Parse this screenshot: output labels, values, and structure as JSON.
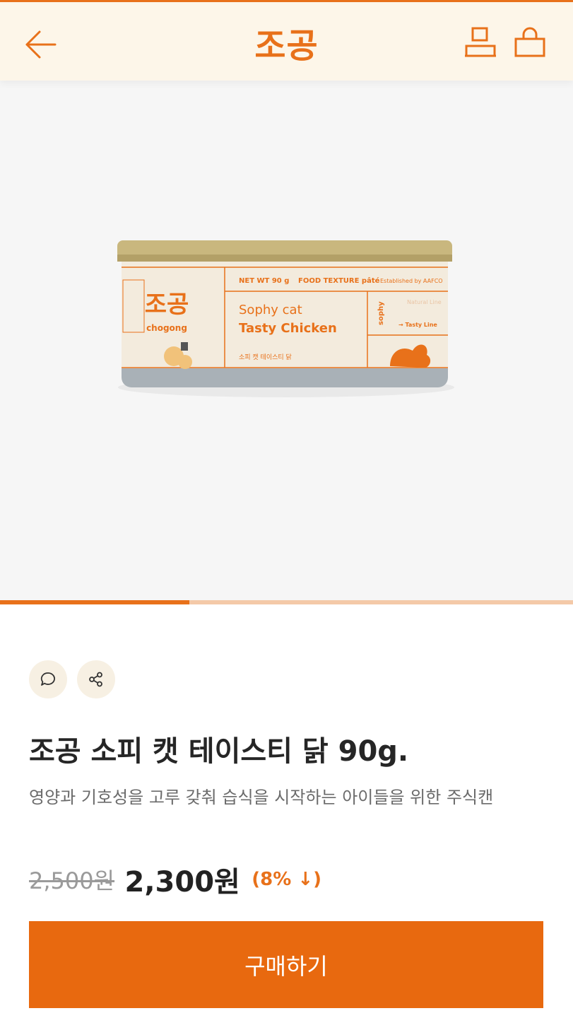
{
  "header": {
    "logo_text": "조공",
    "back_icon": "arrow-left-icon",
    "user_icon": "user-icon",
    "bag_icon": "shopping-bag-icon"
  },
  "product_image": {
    "label_brand": "조공",
    "label_brand_en": "chogong",
    "label_net_wt": "NET WT 90 g",
    "label_texture": "FOOD TEXTURE pâté",
    "label_established": "Established by AAFCO",
    "label_line": "Sophy cat",
    "label_flavor": "Tasty Chicken",
    "label_korean": "소피 캣 테이스티 닭",
    "label_side": "sophy",
    "label_natural": "Natural Line",
    "label_tasty_line": "→ Tasty Line"
  },
  "gallery": {
    "progress": 0.33
  },
  "actions": {
    "comment_icon": "speech-bubble-icon",
    "share_icon": "share-icon"
  },
  "product": {
    "title": "조공 소피 캣 테이스티 닭 90g.",
    "subtitle": "영양과 기호성을 고루 갖춰 습식을 시작하는 아이들을 위한 주식캔",
    "original_price": "2,500원",
    "sale_price": "2,300원",
    "discount": "(8% ↓)"
  },
  "buy_button": {
    "label": "구매하기"
  },
  "colors": {
    "accent": "#e8711a",
    "header_bg": "#fdf6e9",
    "button": "#e8690f"
  }
}
